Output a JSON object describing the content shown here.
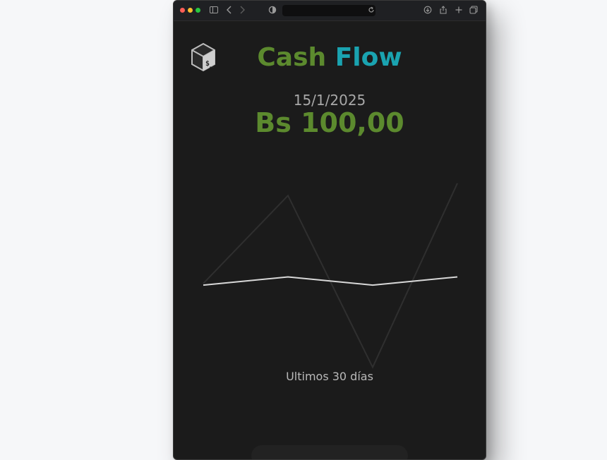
{
  "app": {
    "title_word1": "Cash",
    "title_word2": "Flow",
    "date": "15/1/2025",
    "amount": "Bs 100,00",
    "caption": "Ultimos 30 días",
    "icons": {
      "logo": "terminal-cube-icon",
      "sidebar": "sidebar-icon",
      "back": "chevron-left-icon",
      "forward": "chevron-right-icon",
      "privacy": "shield-icon",
      "reload": "reload-icon",
      "download": "download-icon",
      "share": "share-icon",
      "new_tab": "plus-icon",
      "tabs": "tabs-overview-icon"
    },
    "colors": {
      "brand_green": "#5c8a2e",
      "brand_teal": "#1aa3b0",
      "background": "#1b1b1b"
    }
  },
  "chart_data": {
    "type": "line",
    "x": [
      1,
      2,
      3,
      4
    ],
    "series": [
      {
        "values": [
          90,
          100,
          90,
          100
        ],
        "color": "#d8d8d8"
      },
      {
        "values": [
          92,
          200,
          -11,
          215
        ],
        "color": "#2f2f2f"
      }
    ],
    "ylim": [
      -20,
      240
    ],
    "title": "",
    "xlabel": "",
    "ylabel": "",
    "grid": false,
    "legend": "none"
  }
}
